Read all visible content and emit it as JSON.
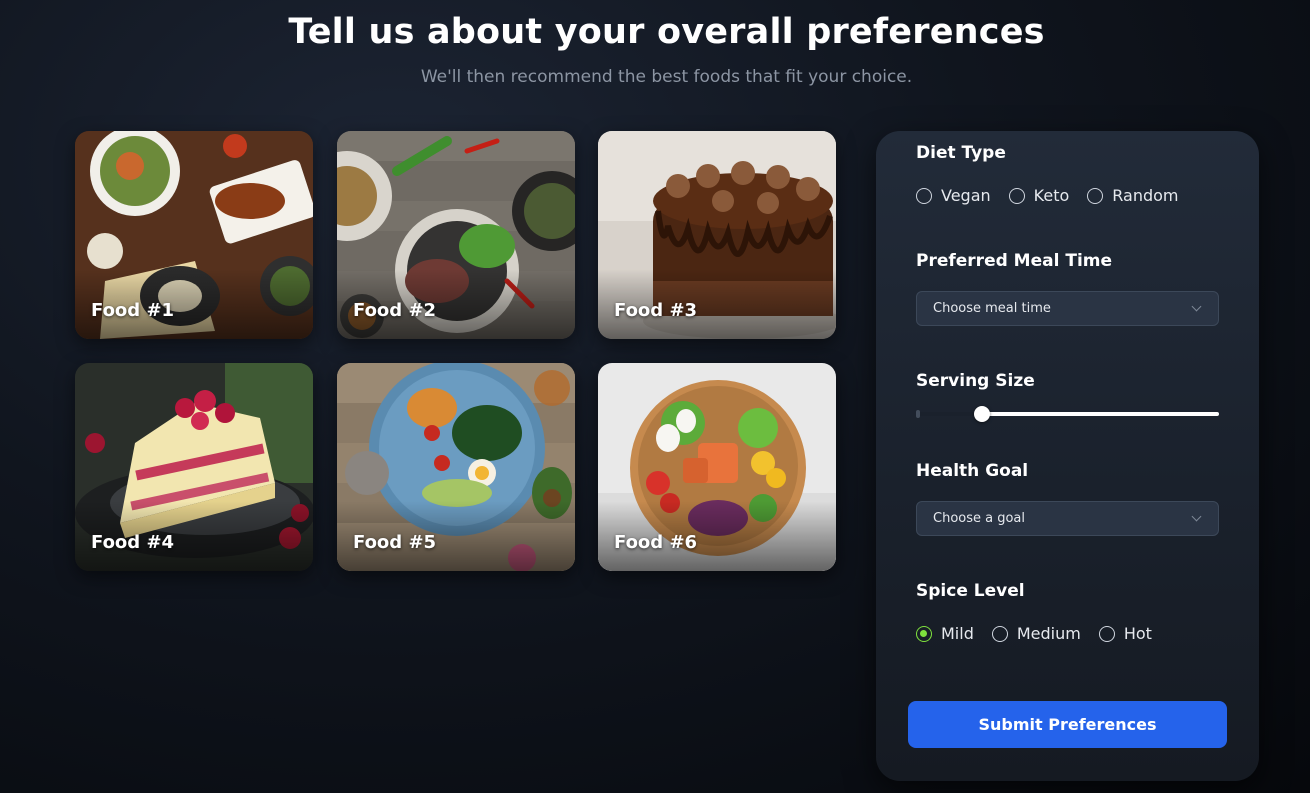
{
  "header": {
    "title": "Tell us about your overall preferences",
    "subtitle": "We'll then recommend the best foods that fit your choice."
  },
  "foods": [
    {
      "label": "Food #1"
    },
    {
      "label": "Food #2"
    },
    {
      "label": "Food #3"
    },
    {
      "label": "Food #4"
    },
    {
      "label": "Food #5"
    },
    {
      "label": "Food #6"
    }
  ],
  "preferences": {
    "diet_type": {
      "title": "Diet Type",
      "options": [
        "Vegan",
        "Keto",
        "Random"
      ],
      "selected": null
    },
    "meal_time": {
      "title": "Preferred Meal Time",
      "placeholder": "Choose meal time"
    },
    "serving_size": {
      "title": "Serving Size",
      "value_fraction": 0.2
    },
    "health_goal": {
      "title": "Health Goal",
      "placeholder": "Choose a goal"
    },
    "spice_level": {
      "title": "Spice Level",
      "options": [
        "Mild",
        "Medium",
        "Hot"
      ],
      "selected": "Mild"
    },
    "submit_label": "Submit Preferences"
  },
  "colors": {
    "accent_button": "#2563eb",
    "radio_selected": "#7ee03d",
    "panel_bg": "#1d2430"
  }
}
